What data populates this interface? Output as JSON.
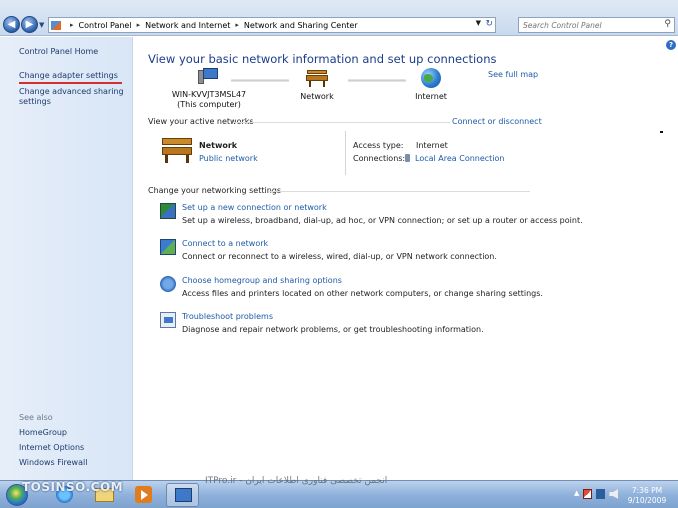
{
  "address_bar": {
    "breadcrumbs": [
      "Control Panel",
      "Network and Internet",
      "Network and Sharing Center"
    ],
    "search_placeholder": "Search Control Panel"
  },
  "sidebar": {
    "home": "Control Panel Home",
    "links": [
      "Change adapter settings",
      "Change advanced sharing settings"
    ],
    "see_also_heading": "See also",
    "see_also": [
      "HomeGroup",
      "Internet Options",
      "Windows Firewall"
    ]
  },
  "main": {
    "title": "View your basic network information and set up connections",
    "see_full_map": "See full map",
    "map": {
      "computer_name": "WIN-KVVJT3MSL47",
      "computer_sub": "(This computer)",
      "network": "Network",
      "internet": "Internet"
    },
    "active_networks": {
      "heading": "View your active networks",
      "connect_disconnect": "Connect or disconnect",
      "network_name": "Network",
      "network_type": "Public network",
      "access_type_label": "Access type:",
      "access_type_value": "Internet",
      "connections_label": "Connections:",
      "connections_value": "Local Area Connection"
    },
    "settings": {
      "heading": "Change your networking settings",
      "tasks": [
        {
          "title": "Set up a new connection or network",
          "desc": "Set up a wireless, broadband, dial-up, ad hoc, or VPN connection; or set up a router or access point."
        },
        {
          "title": "Connect to a network",
          "desc": "Connect or reconnect to a wireless, wired, dial-up, or VPN network connection."
        },
        {
          "title": "Choose homegroup and sharing options",
          "desc": "Access files and printers located on other network computers, or change sharing settings."
        },
        {
          "title": "Troubleshoot problems",
          "desc": "Diagnose and repair network problems, or get troubleshooting information."
        }
      ]
    }
  },
  "taskbar": {
    "time": "7:36 PM",
    "date": "9/10/2009"
  },
  "watermarks": {
    "left": "TOSINSO.COM",
    "center": "ITPro.ir - انجمن تخصصی فناوری اطلاعات ایران"
  },
  "colors": {
    "link": "#1e5aa8",
    "title": "#1e3c8c",
    "sidebar_bg": "#e6eef9",
    "highlight_underline": "#d0302e"
  }
}
